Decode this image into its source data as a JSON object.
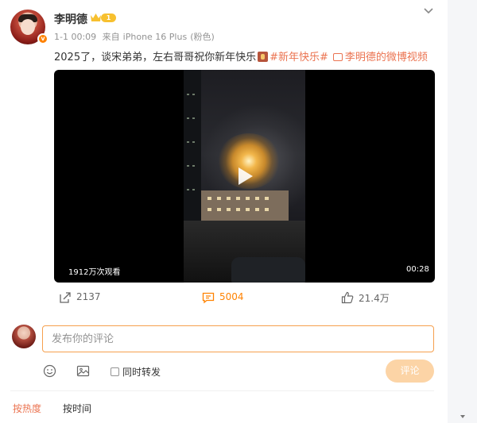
{
  "post": {
    "author": "李明德",
    "level": "1",
    "timestamp": "1-1 00:09",
    "source_prefix": "来自",
    "source_device": "iPhone 16 Plus",
    "source_group": "(粉色)",
    "text": "2025了，谈宋弟弟，左右哥哥祝你新年快乐",
    "hashtag": "#新年快乐#",
    "video_link": "李明德的微博视频"
  },
  "video": {
    "view_count": "1912万次观看",
    "duration": "00:28"
  },
  "actions": {
    "share_count": "2137",
    "comment_count": "5004",
    "like_count": "21.4万"
  },
  "comment_box": {
    "placeholder": "发布你的评论",
    "repost_label": "同时转发",
    "submit_label": "评论"
  },
  "sort": {
    "hot_label": "按热度",
    "time_label": "按时间"
  },
  "colors": {
    "accent": "#ff8200",
    "tag": "#eb7350",
    "input_border": "#f6a04e",
    "submit_disabled": "#fcd4a6"
  },
  "icons": [
    "chevron-down-icon",
    "crown-icon",
    "play-icon",
    "share-icon",
    "comment-icon",
    "like-icon",
    "emoji-icon",
    "image-icon",
    "checkbox-icon"
  ]
}
